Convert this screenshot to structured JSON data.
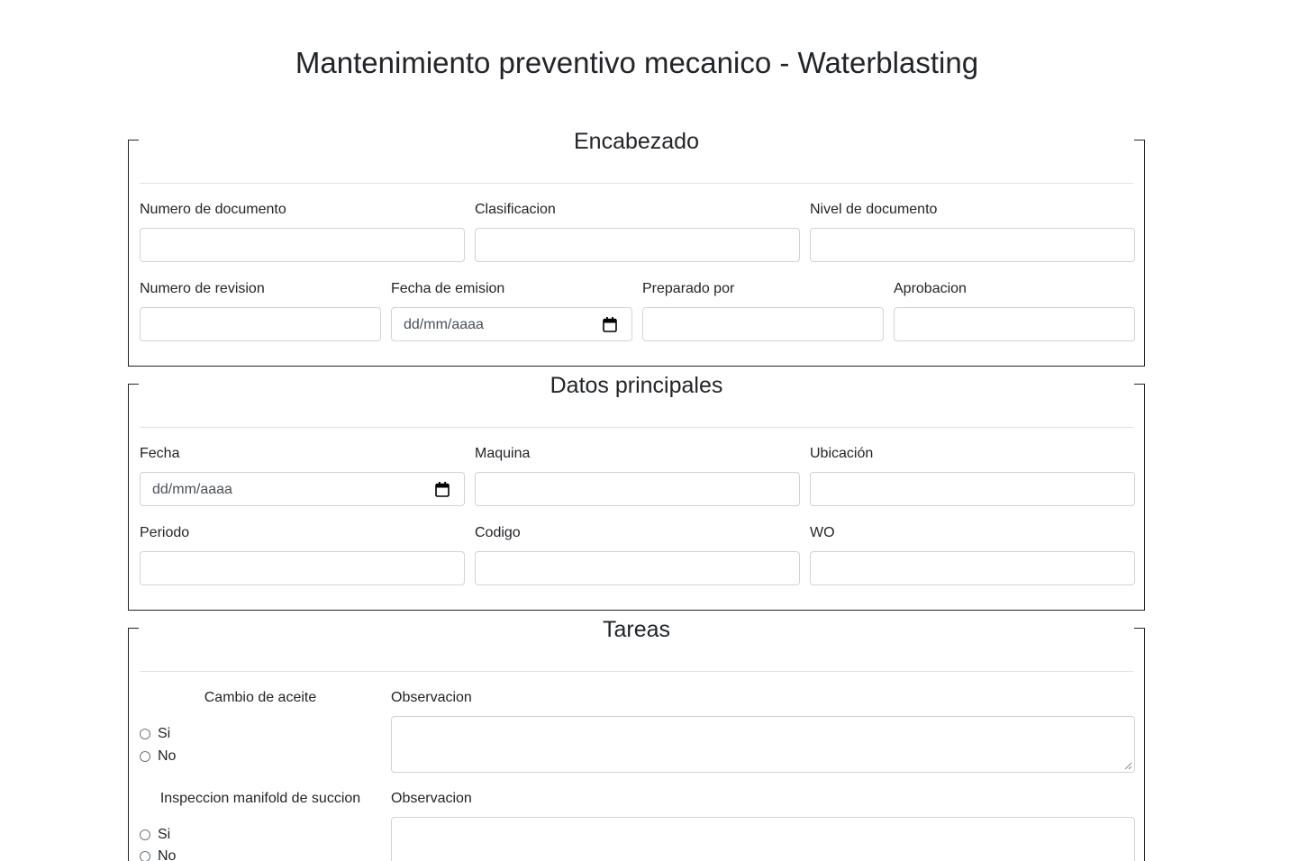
{
  "page": {
    "title": "Mantenimiento preventivo mecanico - Waterblasting"
  },
  "encabezado": {
    "legend": "Encabezado",
    "numero_documento": {
      "label": "Numero de documento",
      "value": ""
    },
    "clasificacion": {
      "label": "Clasificacion",
      "value": ""
    },
    "nivel_documento": {
      "label": "Nivel de documento",
      "value": ""
    },
    "numero_revision": {
      "label": "Numero de revision",
      "value": ""
    },
    "fecha_emision": {
      "label": "Fecha de emision",
      "placeholder": "dd/mm/aaaa"
    },
    "preparado_por": {
      "label": "Preparado por",
      "value": ""
    },
    "aprobacion": {
      "label": "Aprobacion",
      "value": ""
    }
  },
  "datos_principales": {
    "legend": "Datos principales",
    "fecha": {
      "label": "Fecha",
      "placeholder": "dd/mm/aaaa"
    },
    "maquina": {
      "label": "Maquina",
      "value": ""
    },
    "ubicacion": {
      "label": "Ubicación",
      "value": ""
    },
    "periodo": {
      "label": "Periodo",
      "value": ""
    },
    "codigo": {
      "label": "Codigo",
      "value": ""
    },
    "wo": {
      "label": "WO",
      "value": ""
    }
  },
  "tareas": {
    "legend": "Tareas",
    "items": [
      {
        "title": "Cambio de aceite",
        "option_yes": "Si",
        "option_no": "No",
        "obs_label": "Observacion"
      },
      {
        "title": "Inspeccion manifold de succion",
        "option_yes": "Si",
        "option_no": "No",
        "obs_label": "Observacion"
      }
    ]
  }
}
